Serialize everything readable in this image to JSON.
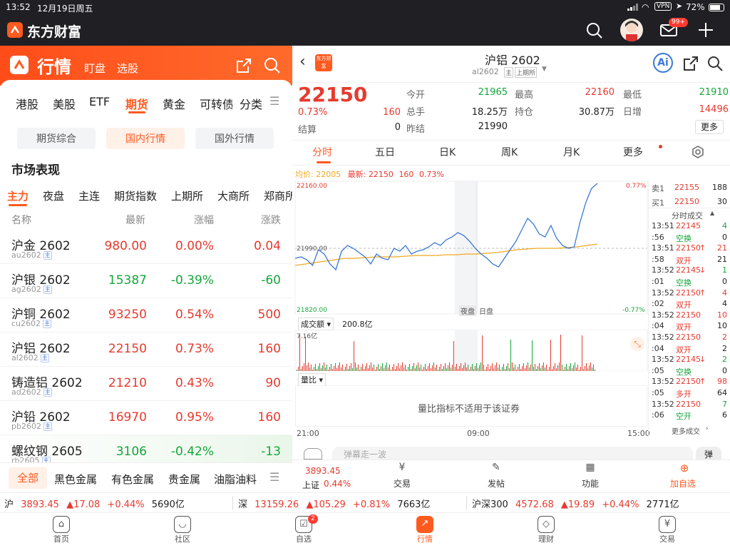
{
  "status": {
    "time": "13:52",
    "date": "12月19日周五",
    "vpn": "VPN",
    "battery": "72%"
  },
  "app": {
    "name": "东方财富",
    "mail_badge": "99+"
  },
  "left": {
    "title": "行情",
    "sub1": "盯盘",
    "sub2": "选股",
    "tabs": [
      "港股",
      "美股",
      "ETF",
      "期货",
      "黄金",
      "可转债",
      "分类"
    ],
    "chips": [
      "期货综合",
      "国内行情",
      "国外行情"
    ],
    "section": "市场表现",
    "subtabs": [
      "主力",
      "夜盘",
      "主连",
      "期货指数",
      "上期所",
      "大商所",
      "郑商所"
    ],
    "cols": [
      "名称",
      "最新",
      "涨幅",
      "涨跌"
    ],
    "rows": [
      {
        "name": "沪金 2602",
        "code": "au2602",
        "tag": "主",
        "last": "980.00",
        "pct": "0.00%",
        "chg": "0.04"
      },
      {
        "name": "沪银 2602",
        "code": "ag2602",
        "tag": "主",
        "last": "15387",
        "pct": "-0.39%",
        "chg": "-60"
      },
      {
        "name": "沪铜 2602",
        "code": "cu2602",
        "tag": "主",
        "last": "93250",
        "pct": "0.54%",
        "chg": "500"
      },
      {
        "name": "沪铝 2602",
        "code": "al2602",
        "tag": "主",
        "last": "22150",
        "pct": "0.73%",
        "chg": "160"
      },
      {
        "name": "铸造铝 2602",
        "code": "ad2602",
        "tag": "主",
        "last": "21210",
        "pct": "0.43%",
        "chg": "90"
      },
      {
        "name": "沪铅 2602",
        "code": "pb2602",
        "tag": "主",
        "last": "16970",
        "pct": "0.95%",
        "chg": "160"
      },
      {
        "name": "螺纹钢 2605",
        "code": "rb2605",
        "tag": "主",
        "last": "3106",
        "pct": "-0.42%",
        "chg": "-13"
      }
    ],
    "cats": [
      "全部",
      "黑色金属",
      "有色金属",
      "贵金属",
      "油脂油料"
    ]
  },
  "right": {
    "title": "沪铝 2602",
    "code": "al2602",
    "tag1": "主",
    "tag2": "上期所",
    "logo": "东方财富",
    "price": "22150",
    "pct": "0.73%",
    "chg": "160",
    "settle_label": "结算",
    "settle": "0",
    "q": [
      {
        "l": "今开",
        "v": "21965",
        "c": "green"
      },
      {
        "l": "最高",
        "v": "22160",
        "c": "red"
      },
      {
        "l": "最低",
        "v": "21910",
        "c": "green"
      },
      {
        "l": "总手",
        "v": "18.25万",
        "c": "dark"
      },
      {
        "l": "持仓",
        "v": "30.87万",
        "c": "dark"
      },
      {
        "l": "日增",
        "v": "14496",
        "c": "red"
      },
      {
        "l": "昨结",
        "v": "21990",
        "c": "dark"
      }
    ],
    "more": "更多",
    "tabs": [
      "分时",
      "五日",
      "日K",
      "周K",
      "月K",
      "更多"
    ],
    "legend": {
      "avg_label": "均价:",
      "avg": "22005",
      "last_label": "最新:",
      "last": "22150",
      "chg": "160",
      "pct": "0.73%"
    },
    "yhigh": "22160.00",
    "ymid": "21990.00",
    "ylow": "21820.00",
    "phigh": "0.77%",
    "plow": "-0.77%",
    "night": "夜盘",
    "day": "日盘",
    "vol_label": "成交额",
    "vol_total": "200.8亿",
    "vol_max": "7.16亿",
    "ratio_label": "量比",
    "ratio_note": "量比指标不适用于该证券",
    "xticks": [
      "21:00",
      "09:00",
      "15:00"
    ],
    "book": [
      {
        "l": "卖1",
        "p": "22155",
        "v": "188"
      },
      {
        "l": "买1",
        "p": "22150",
        "v": "30"
      }
    ],
    "trades_title": "分时成交",
    "trades": [
      {
        "t": "13:51",
        "p": "22145",
        "a": "",
        "v": "4",
        "pc": "red",
        "vc": "green"
      },
      {
        "t": ":56",
        "p": "空换",
        "a": "",
        "v": "0",
        "pc": "green",
        "vc": "dark"
      },
      {
        "t": "13:51",
        "p": "22150",
        "a": "↑",
        "v": "21",
        "pc": "red",
        "vc": "red"
      },
      {
        "t": ":58",
        "p": "双开",
        "a": "",
        "v": "21",
        "pc": "red",
        "vc": "dark"
      },
      {
        "t": "13:52",
        "p": "22145",
        "a": "↓",
        "v": "1",
        "pc": "red",
        "vc": "green"
      },
      {
        "t": ":01",
        "p": "空换",
        "a": "",
        "v": "0",
        "pc": "green",
        "vc": "dark"
      },
      {
        "t": "13:52",
        "p": "22150",
        "a": "↑",
        "v": "4",
        "pc": "red",
        "vc": "red"
      },
      {
        "t": ":02",
        "p": "双开",
        "a": "",
        "v": "4",
        "pc": "red",
        "vc": "dark"
      },
      {
        "t": "13:52",
        "p": "22150",
        "a": "",
        "v": "10",
        "pc": "red",
        "vc": "red"
      },
      {
        "t": ":04",
        "p": "双开",
        "a": "",
        "v": "10",
        "pc": "red",
        "vc": "dark"
      },
      {
        "t": "13:52",
        "p": "22150",
        "a": "",
        "v": "2",
        "pc": "red",
        "vc": "red"
      },
      {
        "t": ":04",
        "p": "双开",
        "a": "",
        "v": "2",
        "pc": "red",
        "vc": "dark"
      },
      {
        "t": "13:52",
        "p": "22145",
        "a": "↓",
        "v": "2",
        "pc": "red",
        "vc": "green"
      },
      {
        "t": ":05",
        "p": "空换",
        "a": "",
        "v": "0",
        "pc": "green",
        "vc": "dark"
      },
      {
        "t": "13:52",
        "p": "22150",
        "a": "↑",
        "v": "98",
        "pc": "red",
        "vc": "red"
      },
      {
        "t": ":05",
        "p": "多开",
        "a": "",
        "v": "64",
        "pc": "red",
        "vc": "dark"
      },
      {
        "t": "13:52",
        "p": "22150",
        "a": "",
        "v": "7",
        "pc": "red",
        "vc": "green"
      },
      {
        "t": ":06",
        "p": "空开",
        "a": "",
        "v": "6",
        "pc": "green",
        "vc": "dark"
      }
    ],
    "trades_more": "更多成交",
    "comment_placeholder": "弹幕走一波",
    "comment_btn": "弹",
    "bottom": {
      "idx_val": "3893.45",
      "idx_name": "上证",
      "idx_pct": "0.44%",
      "actions": [
        "交易",
        "发帖",
        "功能",
        "加自选"
      ]
    }
  },
  "ticker": [
    {
      "n": "沪",
      "v": "3893.45",
      "c": "17.08",
      "p": "+0.44%",
      "a": "5690亿"
    },
    {
      "n": "深",
      "v": "13159.26",
      "c": "105.29",
      "p": "+0.81%",
      "a": "7663亿"
    },
    {
      "n": "沪深300",
      "v": "4572.68",
      "c": "19.89",
      "p": "+0.44%",
      "a": "2771亿"
    }
  ],
  "nav": [
    {
      "l": "首页"
    },
    {
      "l": "社区"
    },
    {
      "l": "自选",
      "b": "2"
    },
    {
      "l": "行情"
    },
    {
      "l": "理财"
    },
    {
      "l": "交易"
    }
  ],
  "colors": {
    "brand": "#ff5a1f",
    "up": "#e63a2e",
    "down": "#14a63b",
    "line": "#3b78d8",
    "avg": "#f0a821"
  }
}
